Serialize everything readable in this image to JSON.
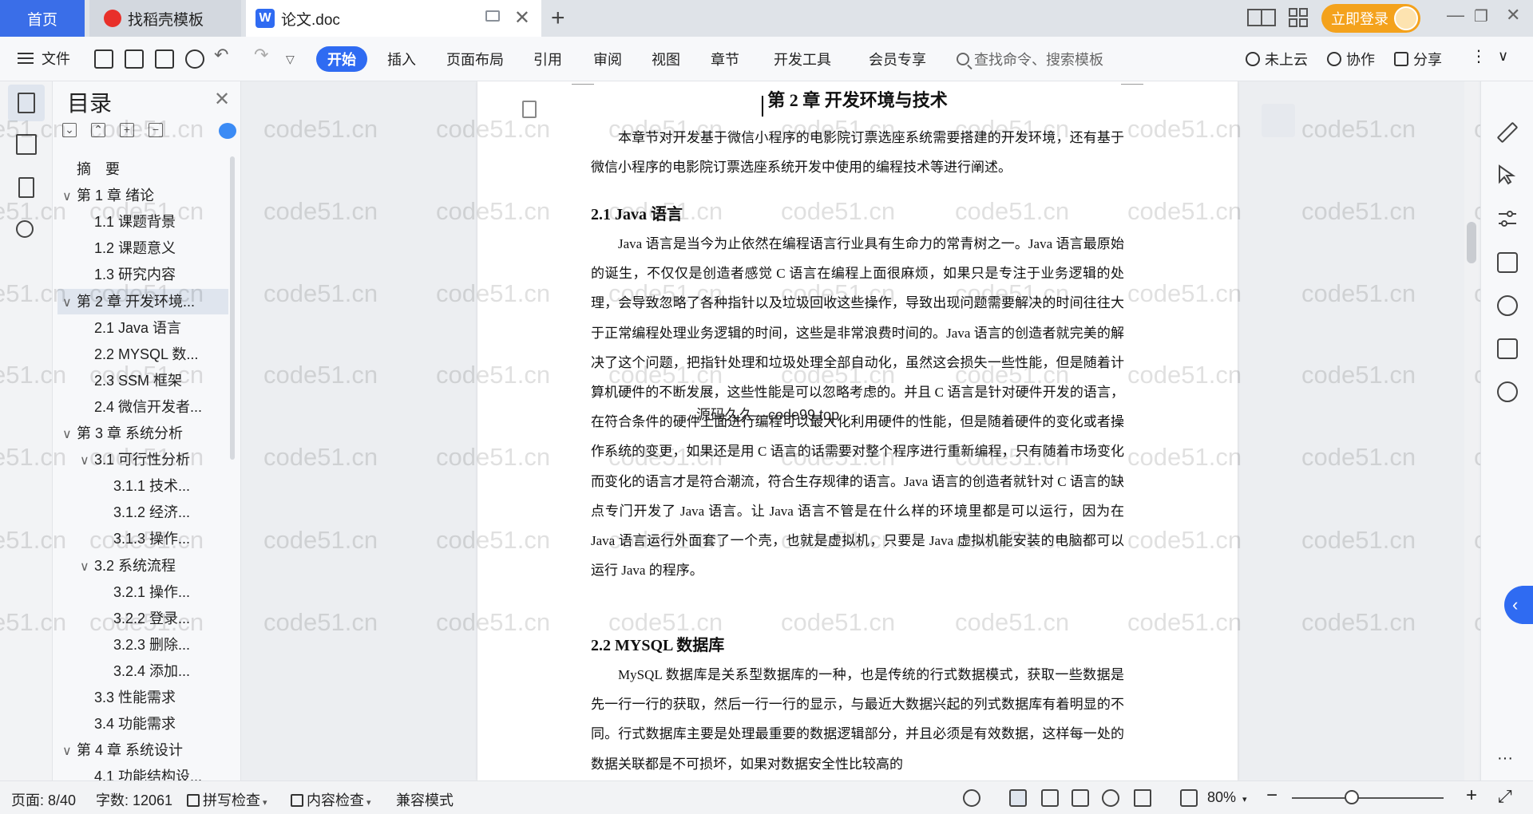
{
  "tabs": {
    "home": "首页",
    "templates": "找稻壳模板",
    "templates_logo": "",
    "doc_title": "论文.doc",
    "doc_logo": "W",
    "new_tab": "+"
  },
  "titlebar": {
    "login_label": "立即登录"
  },
  "ribbon": {
    "file_label": "文件",
    "tabs": [
      "开始",
      "插入",
      "页面布局",
      "引用",
      "审阅",
      "视图",
      "章节",
      "开发工具",
      "会员专享"
    ],
    "active_tab": "开始",
    "search_placeholder": "查找命令、搜索模板",
    "cloud_label": "未上云",
    "collab_label": "协作",
    "share_label": "分享"
  },
  "toc": {
    "title": "目录",
    "items": [
      {
        "label": "摘　要",
        "level": 1,
        "chevron": ""
      },
      {
        "label": "第 1 章  绪论",
        "level": 1,
        "chevron": "∨"
      },
      {
        "label": "1.1  课题背景",
        "level": 2,
        "chevron": ""
      },
      {
        "label": "1.2  课题意义",
        "level": 2,
        "chevron": ""
      },
      {
        "label": "1.3  研究内容",
        "level": 2,
        "chevron": ""
      },
      {
        "label": "第 2 章  开发环境...",
        "level": 1,
        "chevron": "∨",
        "selected": true
      },
      {
        "label": "2.1 Java 语言",
        "level": 2,
        "chevron": ""
      },
      {
        "label": "2.2 MYSQL 数...",
        "level": 2,
        "chevron": ""
      },
      {
        "label": "2.3 SSM 框架",
        "level": 2,
        "chevron": ""
      },
      {
        "label": "2.4 微信开发者...",
        "level": 2,
        "chevron": ""
      },
      {
        "label": "第 3 章  系统分析",
        "level": 1,
        "chevron": "∨"
      },
      {
        "label": "3.1  可行性分析",
        "level": 2,
        "chevron": "∨"
      },
      {
        "label": "3.1.1  技术...",
        "level": 3,
        "chevron": ""
      },
      {
        "label": "3.1.2  经济...",
        "level": 3,
        "chevron": ""
      },
      {
        "label": "3.1.3  操作...",
        "level": 3,
        "chevron": ""
      },
      {
        "label": "3.2  系统流程",
        "level": 2,
        "chevron": "∨"
      },
      {
        "label": "3.2.1  操作...",
        "level": 3,
        "chevron": ""
      },
      {
        "label": "3.2.2  登录...",
        "level": 3,
        "chevron": ""
      },
      {
        "label": "3.2.3  删除...",
        "level": 3,
        "chevron": ""
      },
      {
        "label": "3.2.4  添加...",
        "level": 3,
        "chevron": ""
      },
      {
        "label": "3.3  性能需求",
        "level": 2,
        "chevron": ""
      },
      {
        "label": "3.4  功能需求",
        "level": 2,
        "chevron": ""
      },
      {
        "label": "第 4 章  系统设计",
        "level": 1,
        "chevron": "∨"
      },
      {
        "label": "4.1  功能结构设...",
        "level": 2,
        "chevron": ""
      }
    ]
  },
  "document": {
    "chapter_title": "第 2 章  开发环境与技术",
    "intro": "本章节对开发基于微信小程序的电影院订票选座系统需要搭建的开发环境，还有基于微信小程序的电影院订票选座系统开发中使用的编程技术等进行阐述。",
    "sec1_title": "2.1 Java 语言",
    "sec1_para": "Java 语言是当今为止依然在编程语言行业具有生命力的常青树之一。Java 语言最原始的诞生，不仅仅是创造者感觉 C 语言在编程上面很麻烦，如果只是专注于业务逻辑的处理，会导致忽略了各种指针以及垃圾回收这些操作，导致出现问题需要解决的时间往往大于正常编程处理业务逻辑的时间，这些是非常浪费时间的。Java 语言的创造者就完美的解决了这个问题，把指针处理和垃圾处理全部自动化，虽然这会损失一些性能，但是随着计算机硬件的不断发展，这些性能是可以忽略考虑的。并且 C 语言是针对硬件开发的语言，在符合条件的硬件上面进行编程可以最大化利用硬件的性能，但是随着硬件的变化或者操作系统的变更，如果还是用 C 语言的话需要对整个程序进行重新编程，只有随着市场变化而变化的语言才是符合潮流，符合生存规律的语言。Java 语言的创造者就针对 C 语言的缺点专门开发了 Java 语言。让 Java 语言不管是在什么样的环境里都是可以运行，因为在 Java 语言运行外面套了一个壳，也就是虚拟机，只要是 Java 虚拟机能安装的电脑都可以运行 Java 的程序。",
    "sec2_title": "2.2 MYSQL 数据库",
    "sec2_para": "MySQL 数据库是关系型数据库的一种，也是传统的行式数据模式，获取一些数据是先一行一行的获取，然后一行一行的显示，与最近大数据兴起的列式数据库有着明显的不同。行式数据库主要是处理最重要的数据逻辑部分，并且必须是有效数据，这样每一处的数据关联都是不可损坏，如果对数据安全性比较高的",
    "overlay_text": "源码久久—code99.top",
    "watermark": "code51.cn"
  },
  "statusbar": {
    "page": "页面: 8/40",
    "words": "字数: 12061",
    "spell": "拼写检查",
    "content_check": "内容检查",
    "compat": "兼容模式",
    "zoom": "80%"
  }
}
